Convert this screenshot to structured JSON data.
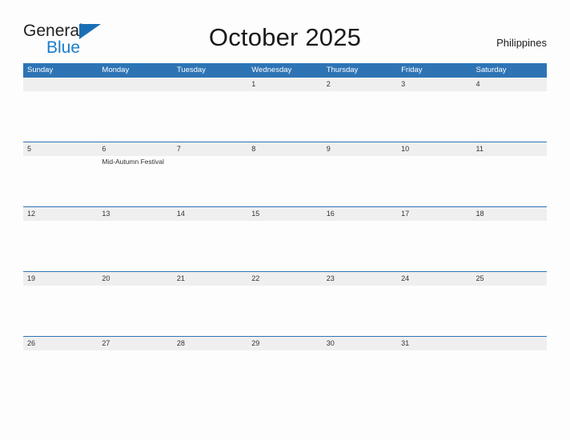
{
  "brand": {
    "name_part1": "General",
    "name_part2": "Blue",
    "triangle_color": "#1a6fb4",
    "blue_text_color": "#1a7cc8"
  },
  "header": {
    "title": "October 2025",
    "country": "Philippines"
  },
  "colors": {
    "header_bar": "#2e74b5",
    "date_band": "#efefef",
    "row_rule": "#2e74b5",
    "page_background": "#fdfdfd",
    "text": "#333333"
  },
  "calendar": {
    "month": "October",
    "year": "2025",
    "weekday_headers": [
      "Sunday",
      "Monday",
      "Tuesday",
      "Wednesday",
      "Thursday",
      "Friday",
      "Saturday"
    ],
    "weeks": [
      {
        "days": [
          {
            "date": "",
            "events": []
          },
          {
            "date": "",
            "events": []
          },
          {
            "date": "",
            "events": []
          },
          {
            "date": "1",
            "events": []
          },
          {
            "date": "2",
            "events": []
          },
          {
            "date": "3",
            "events": []
          },
          {
            "date": "4",
            "events": []
          }
        ]
      },
      {
        "days": [
          {
            "date": "5",
            "events": []
          },
          {
            "date": "6",
            "events": [
              "Mid-Autumn Festival"
            ]
          },
          {
            "date": "7",
            "events": []
          },
          {
            "date": "8",
            "events": []
          },
          {
            "date": "9",
            "events": []
          },
          {
            "date": "10",
            "events": []
          },
          {
            "date": "11",
            "events": []
          }
        ]
      },
      {
        "days": [
          {
            "date": "12",
            "events": []
          },
          {
            "date": "13",
            "events": []
          },
          {
            "date": "14",
            "events": []
          },
          {
            "date": "15",
            "events": []
          },
          {
            "date": "16",
            "events": []
          },
          {
            "date": "17",
            "events": []
          },
          {
            "date": "18",
            "events": []
          }
        ]
      },
      {
        "days": [
          {
            "date": "19",
            "events": []
          },
          {
            "date": "20",
            "events": []
          },
          {
            "date": "21",
            "events": []
          },
          {
            "date": "22",
            "events": []
          },
          {
            "date": "23",
            "events": []
          },
          {
            "date": "24",
            "events": []
          },
          {
            "date": "25",
            "events": []
          }
        ]
      },
      {
        "days": [
          {
            "date": "26",
            "events": []
          },
          {
            "date": "27",
            "events": []
          },
          {
            "date": "28",
            "events": []
          },
          {
            "date": "29",
            "events": []
          },
          {
            "date": "30",
            "events": []
          },
          {
            "date": "31",
            "events": []
          },
          {
            "date": "",
            "events": []
          }
        ]
      }
    ]
  }
}
